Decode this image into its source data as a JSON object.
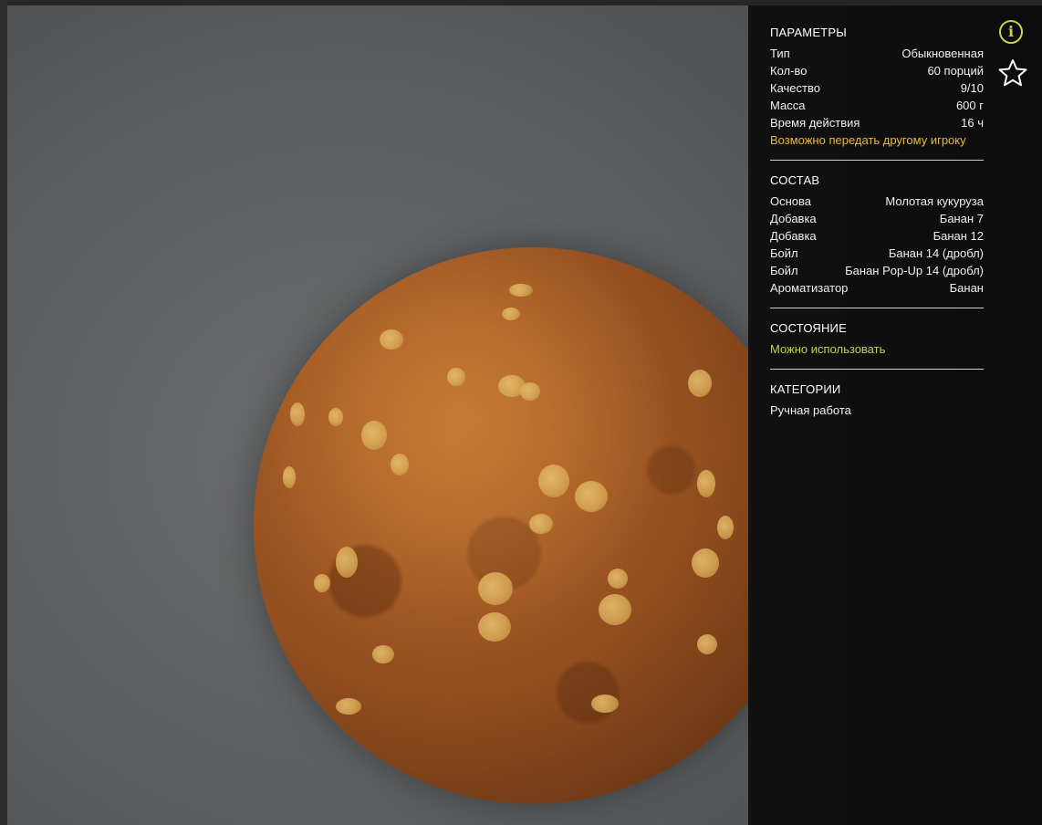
{
  "parameters": {
    "title": "ПАРАМЕТРЫ",
    "rows": [
      {
        "key": "Тип",
        "value": "Обыкновенная"
      },
      {
        "key": "Кол-во",
        "value": "60 порций"
      },
      {
        "key": "Качество",
        "value": "9/10"
      },
      {
        "key": "Масса",
        "value": "600 г"
      },
      {
        "key": "Время действия",
        "value": "16 ч"
      }
    ],
    "transfer_note": "Возможно передать другому игроку"
  },
  "composition": {
    "title": "СОСТАВ",
    "rows": [
      {
        "key": "Основа",
        "value": "Молотая кукуруза"
      },
      {
        "key": "Добавка",
        "value": "Банан 7"
      },
      {
        "key": "Добавка",
        "value": "Банан 12"
      },
      {
        "key": "Бойл",
        "value": "Банан 14 (дробл)"
      },
      {
        "key": "Бойл",
        "value": "Банан Pop-Up 14 (дробл)"
      },
      {
        "key": "Ароматизатор",
        "value": "Банан"
      }
    ]
  },
  "state": {
    "title": "СОСТОЯНИЕ",
    "value": "Можно использовать"
  },
  "categories": {
    "title": "КАТЕГОРИИ",
    "value": "Ручная работа"
  },
  "icons": {
    "info": "info-icon",
    "favorite": "star-icon"
  },
  "colors": {
    "accent_yellow": "#e9b93a",
    "accent_green": "#c6d24a",
    "panel_bg": "#0f0f0f"
  }
}
